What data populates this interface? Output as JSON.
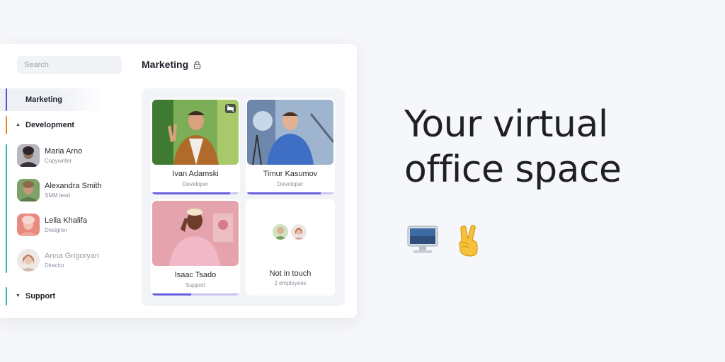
{
  "sidebar": {
    "search_placeholder": "Search",
    "groups": [
      {
        "label": "Marketing",
        "color": "#5b4fd0"
      },
      {
        "label": "Development",
        "color": "#e08a2c"
      },
      {
        "label": "Support",
        "color": "#2bb3b6"
      }
    ],
    "members": [
      {
        "name": "Maria Arno",
        "role": "Copywriter"
      },
      {
        "name": "Alexandra Smith",
        "role": "SMM lead"
      },
      {
        "name": "Leila Khalifa",
        "role": "Designer"
      },
      {
        "name": "Anna Grigoryan",
        "role": "Director"
      }
    ]
  },
  "main": {
    "room_title": "Marketing",
    "tiles": [
      {
        "name": "Ivan Adamski",
        "role": "Developer",
        "progress": 0.9,
        "camera_off_icon": "camera-off-icon"
      },
      {
        "name": "Timur Kasumov",
        "role": "Developer",
        "progress": 0.85
      },
      {
        "name": "Isaac Tsado",
        "role": "Support",
        "progress": 0.45
      },
      {
        "name": "Not in touch",
        "role": "2 employees"
      }
    ]
  },
  "hero": {
    "headline_line1": "Your virtual",
    "headline_line2": "office space",
    "emojis": [
      "desktop-computer-emoji",
      "victory-hand-emoji"
    ]
  },
  "colors": {
    "accent": "#6b5fe0",
    "background": "#f6f7fa"
  }
}
